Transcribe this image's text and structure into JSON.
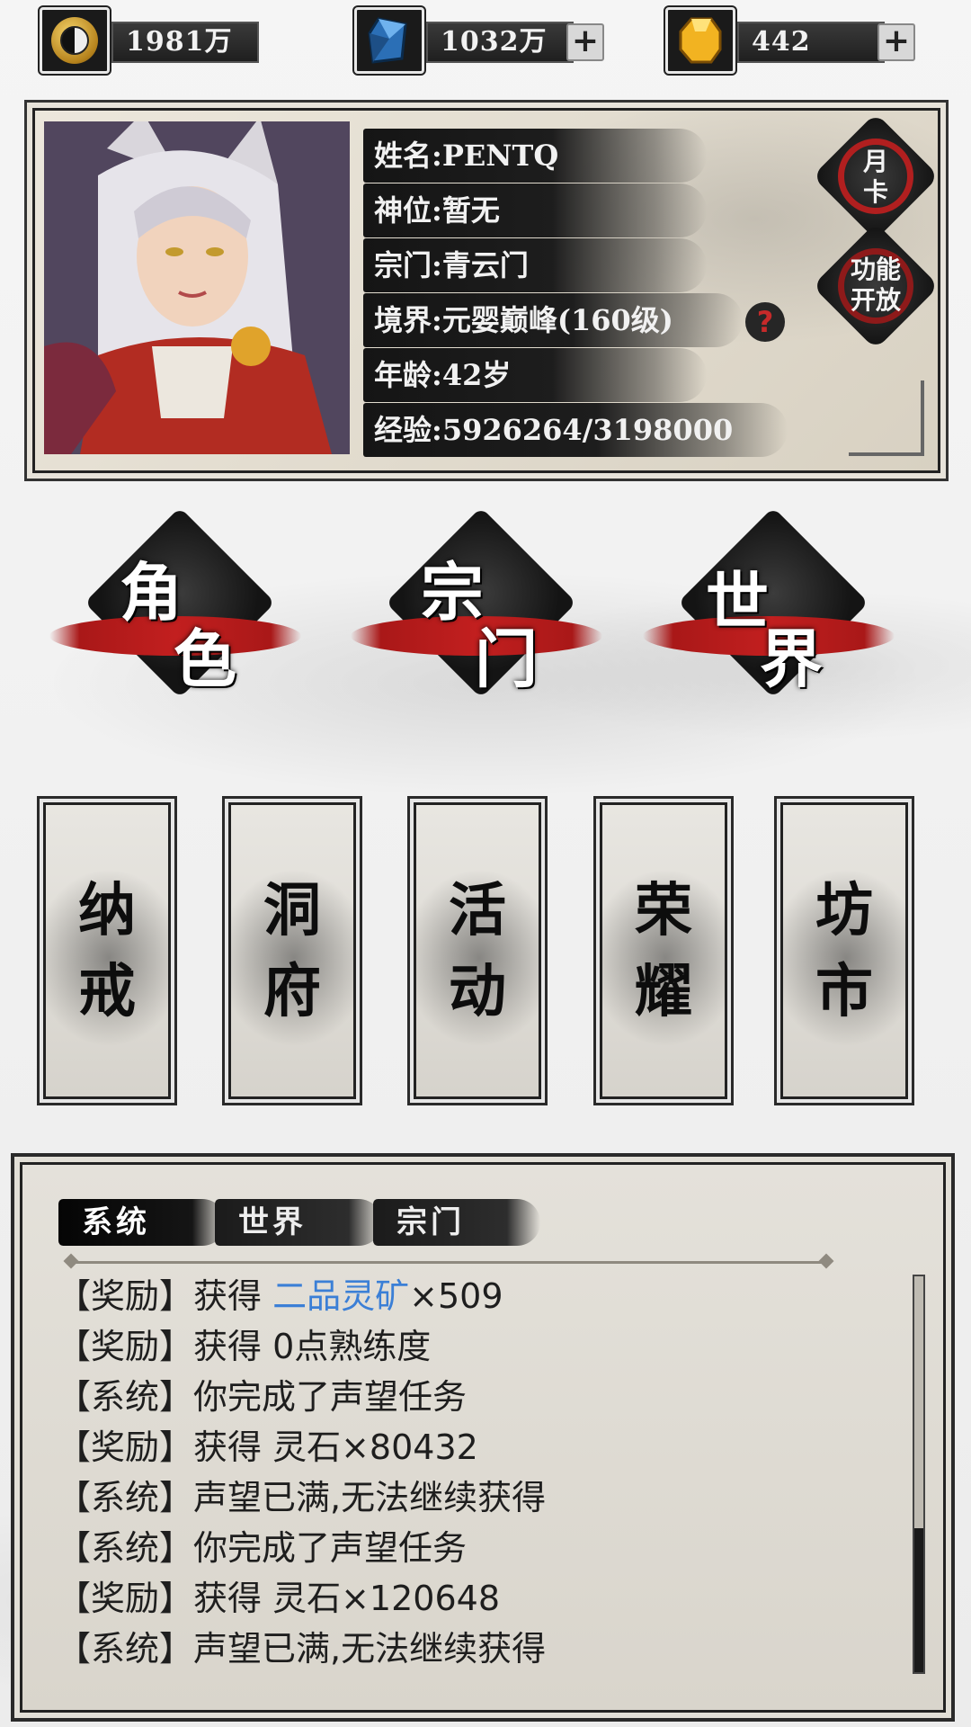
{
  "resources": [
    {
      "name": "taiji-coin",
      "value": "1981万",
      "has_plus": false
    },
    {
      "name": "crystal",
      "value": "1032万",
      "has_plus": true
    },
    {
      "name": "gold-ingot",
      "value": "442",
      "has_plus": true
    }
  ],
  "profile": {
    "name_line": "姓名:PENTQ",
    "deity_line": "神位:暂无",
    "sect_line": "宗门:青云门",
    "realm_line": "境界:元婴巅峰(160级)",
    "age_line": "年龄:42岁",
    "exp_line": "经验:5926264/3198000",
    "help_glyph": "?",
    "monthly_card": "月\n卡",
    "feature_open": "功能\n开放"
  },
  "main_menu": [
    {
      "id": "character",
      "chars": [
        "角",
        "色"
      ]
    },
    {
      "id": "sect",
      "chars": [
        "宗",
        "门"
      ]
    },
    {
      "id": "world",
      "chars": [
        "世",
        "界"
      ]
    }
  ],
  "tiles": [
    {
      "id": "ring",
      "chars": [
        "纳",
        "戒"
      ]
    },
    {
      "id": "cave",
      "chars": [
        "洞",
        "府"
      ]
    },
    {
      "id": "events",
      "chars": [
        "活",
        "动"
      ]
    },
    {
      "id": "glory",
      "chars": [
        "荣",
        "耀"
      ]
    },
    {
      "id": "market",
      "chars": [
        "坊",
        "市"
      ]
    }
  ],
  "chat": {
    "tabs": [
      "系统",
      "世界",
      "宗门"
    ],
    "active_tab": 0,
    "messages": [
      {
        "tag": "【奖励】",
        "pre": "获得 ",
        "highlight": "二品灵矿",
        "post": "×509"
      },
      {
        "tag": "【奖励】",
        "pre": "获得 0点熟练度",
        "highlight": "",
        "post": ""
      },
      {
        "tag": "【系统】",
        "pre": "你完成了声望任务",
        "highlight": "",
        "post": ""
      },
      {
        "tag": "【奖励】",
        "pre": "获得 灵石×80432",
        "highlight": "",
        "post": ""
      },
      {
        "tag": "【系统】",
        "pre": "声望已满,无法继续获得",
        "highlight": "",
        "post": ""
      },
      {
        "tag": "【系统】",
        "pre": "你完成了声望任务",
        "highlight": "",
        "post": ""
      },
      {
        "tag": "【奖励】",
        "pre": "获得 灵石×120648",
        "highlight": "",
        "post": ""
      },
      {
        "tag": "【系统】",
        "pre": "声望已满,无法继续获得",
        "highlight": "",
        "post": ""
      }
    ],
    "highlight_color": "#3b7fd6"
  }
}
